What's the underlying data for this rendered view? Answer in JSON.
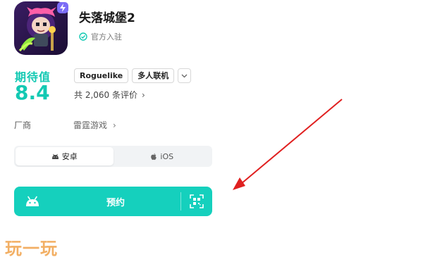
{
  "app": {
    "title": "失落城堡2",
    "official_label": "官方入驻",
    "icon": "game-character-icon"
  },
  "rating": {
    "label": "期待值",
    "value": "8.4"
  },
  "tags": [
    "Roguelike",
    "多人联机"
  ],
  "reviews": {
    "text": "共 2,060 条评价"
  },
  "vendor": {
    "label": "厂商",
    "value": "雷霆游戏"
  },
  "platforms": {
    "active": "安卓",
    "items": [
      {
        "label": "安卓",
        "icon": "android-icon"
      },
      {
        "label": "iOS",
        "icon": "apple-icon"
      }
    ]
  },
  "cta": {
    "label": "预约",
    "left_icon": "android-icon",
    "right_icon": "qr-code-icon"
  },
  "watermark": "玩一玩",
  "colors": {
    "accent": "#15d0bd",
    "rating": "#13c9b3",
    "arrow": "#e02020",
    "watermark": "#f0a24a"
  }
}
